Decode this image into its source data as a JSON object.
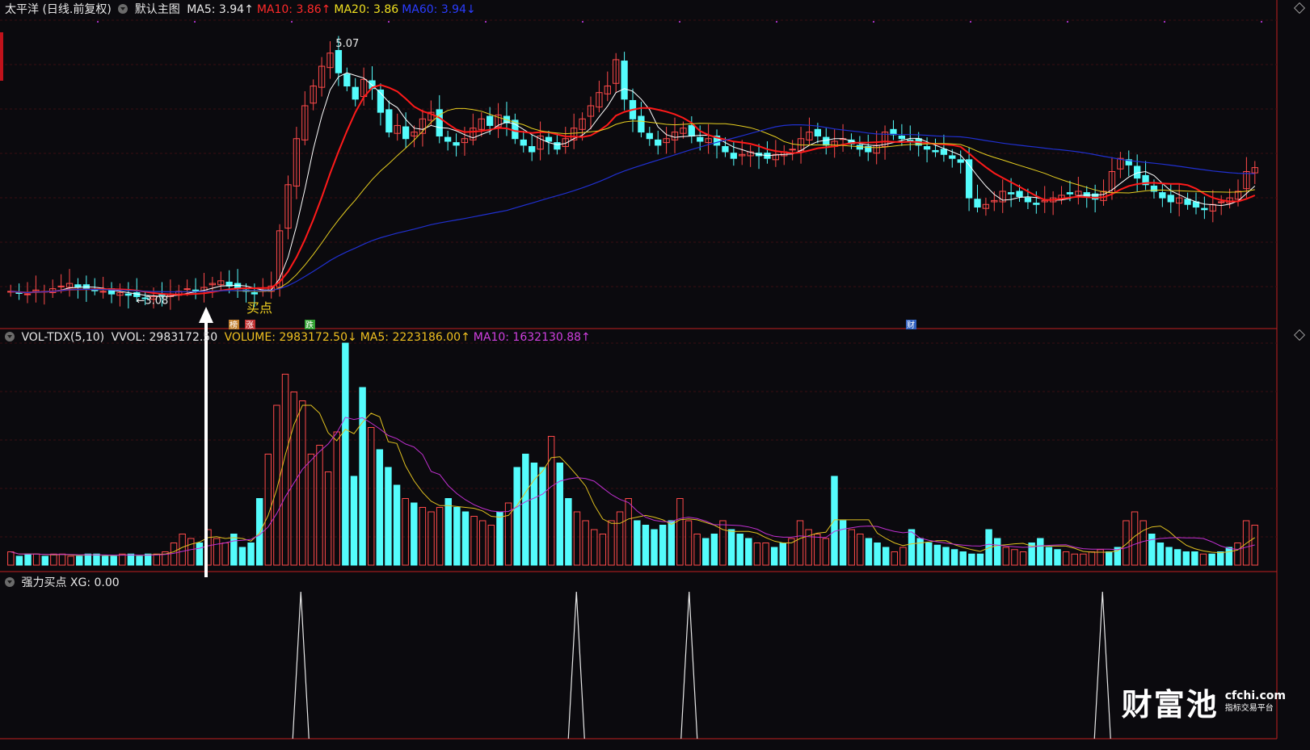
{
  "price_panel": {
    "title": "太平洋 (日线.前复权)",
    "template": "默认主图",
    "ma_labels": [
      {
        "text": "MA5: 3.94",
        "arrow": "↑",
        "color": "#e8e8e8"
      },
      {
        "text": "MA10: 3.86",
        "arrow": "↑",
        "color": "#ff2a2a"
      },
      {
        "text": "MA20: 3.86",
        "arrow": "",
        "color": "#f0e020"
      },
      {
        "text": "MA60: 3.94",
        "arrow": "↓",
        "color": "#2a3cff"
      }
    ],
    "high_label": "5.07",
    "low_label": "←3.08",
    "buy_annotation": "买点",
    "markers": [
      "榜",
      "涨",
      "跌",
      "财"
    ]
  },
  "volume_panel": {
    "title": "VOL-TDX(5,10)",
    "vvol": "VVOL: 2983172.50",
    "labels": [
      {
        "text": "VOLUME: 2983172.50",
        "arrow": "↓",
        "color": "#f0c020"
      },
      {
        "text": "MA5: 2223186.00",
        "arrow": "↑",
        "color": "#f0c020"
      },
      {
        "text": "MA10: 1632130.88",
        "arrow": "↑",
        "color": "#d040e0"
      }
    ]
  },
  "signal_panel": {
    "title": "强力买点 XG: 0.00"
  },
  "watermark": {
    "main": "财富池",
    "domain": "cfchi.com",
    "tagline": "指标交易平台"
  },
  "colors": {
    "background": "#0b0a0e",
    "up": "#ff4a4a",
    "down": "#54fcfc",
    "ma5": "#ffffff",
    "ma10": "#ff1a1a",
    "ma20": "#e8d020",
    "ma60": "#2030d0",
    "vol_ma5": "#e0c020",
    "vol_ma10": "#c030d0",
    "grid": "#3a0e12"
  },
  "chart_data": [
    {
      "type": "candlestick",
      "series_name": "太平洋 (日线.前复权)",
      "ylim": [
        2.9,
        5.2
      ],
      "y_approx_scale": "linear",
      "moving_averages": {
        "MA5": 3.94,
        "MA10": 3.86,
        "MA20": 3.86,
        "MA60": 3.94
      },
      "annotations": {
        "high": 5.07,
        "low": 3.08
      },
      "points_approx_close": [
        3.14,
        3.13,
        3.12,
        3.15,
        3.14,
        3.16,
        3.18,
        3.2,
        3.17,
        3.16,
        3.15,
        3.14,
        3.12,
        3.13,
        3.11,
        3.1,
        3.09,
        3.1,
        3.11,
        3.12,
        3.14,
        3.16,
        3.15,
        3.17,
        3.2,
        3.22,
        3.18,
        3.16,
        3.14,
        3.12,
        3.15,
        3.18,
        3.6,
        3.95,
        4.3,
        4.55,
        4.7,
        4.85,
        4.95,
        4.8,
        4.7,
        4.6,
        4.75,
        4.68,
        4.5,
        4.35,
        4.4,
        4.3,
        4.35,
        4.45,
        4.5,
        4.32,
        4.28,
        4.25,
        4.3,
        4.38,
        4.45,
        4.4,
        4.48,
        4.42,
        4.3,
        4.25,
        4.2,
        4.32,
        4.28,
        4.22,
        4.3,
        4.38,
        4.45,
        4.55,
        4.65,
        4.7,
        4.9,
        4.6,
        4.45,
        4.35,
        4.3,
        4.25,
        4.3,
        4.35,
        4.38,
        4.32,
        4.28,
        4.3,
        4.25,
        4.2,
        4.15,
        4.18,
        4.2,
        4.17,
        4.15,
        4.18,
        4.2,
        4.22,
        4.3,
        4.35,
        4.32,
        4.25,
        4.28,
        4.3,
        4.26,
        4.22,
        4.2,
        4.25,
        4.35,
        4.33,
        4.3,
        4.28,
        4.25,
        4.22,
        4.2,
        4.18,
        4.15,
        4.12,
        3.85,
        3.78,
        3.8,
        3.83,
        3.9,
        3.88,
        3.86,
        3.82,
        3.8,
        3.83,
        3.85,
        3.87,
        3.88,
        3.9,
        3.86,
        3.84,
        3.9,
        4.05,
        4.15,
        4.1,
        4.0,
        3.95,
        3.9,
        3.85,
        3.82,
        3.85,
        3.8,
        3.78,
        3.76,
        3.8,
        3.82,
        3.85,
        3.9,
        4.05,
        4.08
      ]
    },
    {
      "type": "bar",
      "series_name": "VOL-TDX(5,10)",
      "last_volume": 2983172.5,
      "ma5": 2223186.0,
      "ma10": 1632130.88,
      "values_relative": [
        0.06,
        0.04,
        0.05,
        0.05,
        0.04,
        0.05,
        0.05,
        0.04,
        0.04,
        0.05,
        0.05,
        0.04,
        0.04,
        0.05,
        0.05,
        0.04,
        0.05,
        0.05,
        0.06,
        0.1,
        0.14,
        0.12,
        0.1,
        0.16,
        0.12,
        0.1,
        0.14,
        0.08,
        0.1,
        0.3,
        0.5,
        0.72,
        0.86,
        0.78,
        0.74,
        0.5,
        0.54,
        0.42,
        0.6,
        1.0,
        0.4,
        0.8,
        0.62,
        0.52,
        0.44,
        0.36,
        0.3,
        0.28,
        0.26,
        0.24,
        0.26,
        0.3,
        0.26,
        0.24,
        0.22,
        0.2,
        0.18,
        0.24,
        0.28,
        0.44,
        0.5,
        0.46,
        0.44,
        0.58,
        0.46,
        0.3,
        0.24,
        0.2,
        0.16,
        0.14,
        0.2,
        0.24,
        0.3,
        0.2,
        0.18,
        0.16,
        0.18,
        0.2,
        0.3,
        0.2,
        0.14,
        0.12,
        0.14,
        0.2,
        0.16,
        0.14,
        0.12,
        0.1,
        0.1,
        0.08,
        0.1,
        0.12,
        0.2,
        0.16,
        0.14,
        0.12,
        0.4,
        0.2,
        0.16,
        0.14,
        0.12,
        0.1,
        0.08,
        0.06,
        0.08,
        0.16,
        0.12,
        0.1,
        0.09,
        0.08,
        0.07,
        0.06,
        0.05,
        0.05,
        0.16,
        0.12,
        0.08,
        0.07,
        0.06,
        0.1,
        0.12,
        0.08,
        0.07,
        0.06,
        0.05,
        0.05,
        0.06,
        0.07,
        0.06,
        0.08,
        0.2,
        0.24,
        0.2,
        0.14,
        0.1,
        0.08,
        0.07,
        0.06,
        0.06,
        0.05,
        0.05,
        0.06,
        0.08,
        0.1,
        0.2,
        0.18
      ]
    },
    {
      "type": "line",
      "series_name": "强力买点 XG",
      "value": 0.0,
      "signal_indices": [
        47,
        91,
        109,
        175
      ]
    }
  ]
}
